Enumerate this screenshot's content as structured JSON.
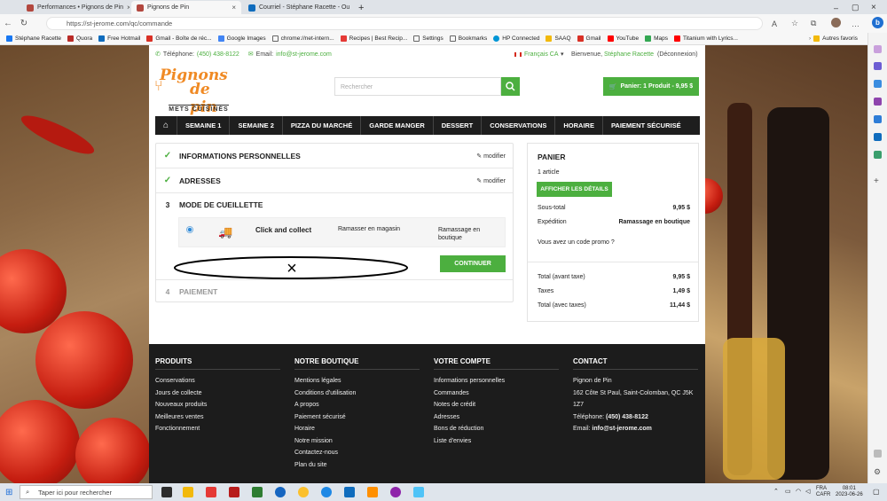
{
  "browser": {
    "tabs": [
      {
        "title": "Performances • Pignons de Pin"
      },
      {
        "title": "Pignons de Pin"
      },
      {
        "title": "Courriel - Stéphane Racette - Ou"
      }
    ],
    "url": "https://st-jerome.com/qc/commande",
    "favorites": [
      "Stéphane Racette",
      "Quora",
      "Free Hotmail",
      "Gmail - Boîte de réc...",
      "Google Images",
      "chrome://net-intern...",
      "Recipes | Best Recip...",
      "Settings",
      "Bookmarks",
      "HP Connected",
      "SAAQ",
      "Gmail",
      "YouTube",
      "Maps",
      "Titanium with Lyrics..."
    ],
    "other_favorites": "Autres favoris"
  },
  "topbar": {
    "phone_label": "Téléphone:",
    "phone": "(450) 438-8122",
    "email_label": "Email:",
    "email": "info@st-jerome.com",
    "language": "Français CA",
    "welcome": "Bienvenue,",
    "user": "Stéphane Racette",
    "logout": "(Déconnexion)"
  },
  "logo": {
    "line1": "Pignons",
    "line2": "de pin",
    "tagline": "METS CUISINÉS"
  },
  "search": {
    "placeholder": "Rechercher"
  },
  "cart": {
    "label": "Panier: 1 Produit - 9,95 $"
  },
  "nav": [
    "SEMAINE 1",
    "SEMAINE 2",
    "PIZZA DU MARCHÉ",
    "GARDE MANGER",
    "DESSERT",
    "CONSERVATIONS",
    "HORAIRE",
    "PAIEMENT SÉCURISÉ"
  ],
  "checkout": {
    "step1": "INFORMATIONS PERSONNELLES",
    "step2": "ADRESSES",
    "modify": "modifier",
    "step3_num": "3",
    "step3": "MODE DE CUEILLETTE",
    "delivery_name": "Click and collect",
    "delivery_desc": "Ramasser en magasin",
    "delivery_price": "Ramassage en boutique",
    "continue": "CONTINUER",
    "annotation": "×",
    "step4_num": "4",
    "step4": "PAIEMENT"
  },
  "summary": {
    "title": "PANIER",
    "count": "1 article",
    "details": "AFFICHER LES DÉTAILS",
    "subtotal_label": "Sous-total",
    "subtotal": "9,95 $",
    "shipping_label": "Expédition",
    "shipping": "Ramassage en boutique",
    "promo": "Vous avez un code promo ?",
    "total_ht_label": "Total (avant taxe)",
    "total_ht": "9,95 $",
    "taxes_label": "Taxes",
    "taxes": "1,49 $",
    "total_label": "Total (avec taxes)",
    "total": "11,44 $"
  },
  "footer": {
    "products_title": "PRODUITS",
    "products": [
      "Conservations",
      "Jours de collecte",
      "Nouveaux produits",
      "Meilleures ventes",
      "Fonctionnement"
    ],
    "shop_title": "NOTRE BOUTIQUE",
    "shop": [
      "Mentions légales",
      "Conditions d'utilisation",
      "A propos",
      "Paiement sécurisé",
      "Horaire",
      "Notre mission",
      "Contactez-nous",
      "Plan du site"
    ],
    "account_title": "VOTRE COMPTE",
    "account": [
      "Informations personnelles",
      "Commandes",
      "Notes de crédit",
      "Adresses",
      "Bons de réduction",
      "Liste d'envies"
    ],
    "contact_title": "CONTACT",
    "contact_name": "Pignon de Pin",
    "contact_addr1": "162 Côte St Paul, Saint-Colomban, QC J5K",
    "contact_addr2": "1Z7",
    "contact_phone_label": "Téléphone:",
    "contact_phone": "(450) 438-8122",
    "contact_email_label": "Email:",
    "contact_email": "info@st-jerome.com"
  },
  "taskbar": {
    "search": "Taper ici pour rechercher",
    "lang1": "FRA",
    "lang2": "CAFR",
    "time": "08:01",
    "date": "2023-06-26"
  }
}
